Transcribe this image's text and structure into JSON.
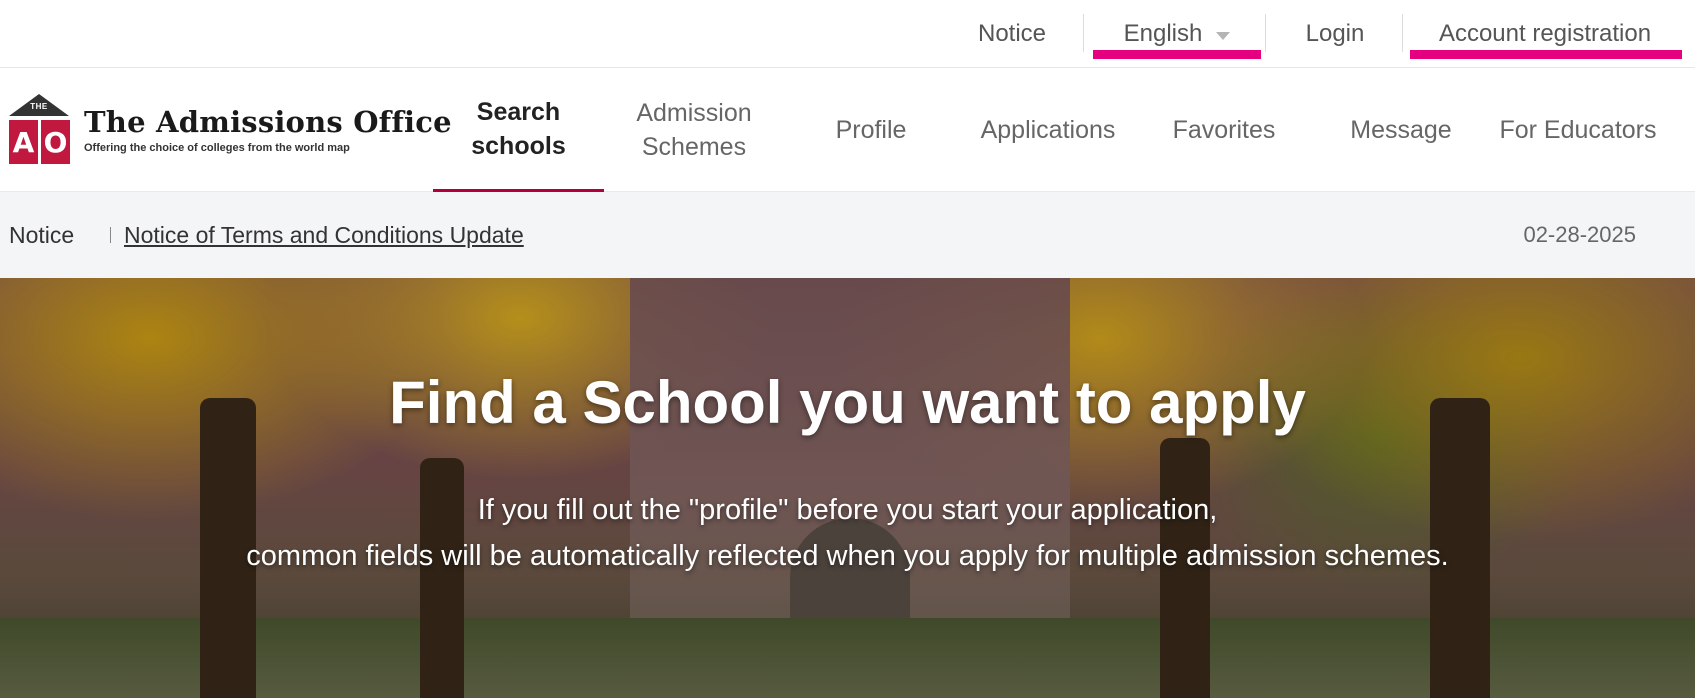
{
  "utility": {
    "notice": "Notice",
    "language": "English",
    "login": "Login",
    "register": "Account registration",
    "accent": "#e5007f"
  },
  "logo": {
    "mark_the": "THE",
    "mark_a": "A",
    "mark_o": "O",
    "title": "The Admissions Office",
    "tagline": "Offering the choice of colleges from the world map",
    "brand_color": "#c0183f"
  },
  "nav": {
    "items": [
      {
        "line1": "Search",
        "line2": "schools",
        "active": true
      },
      {
        "line1": "Admission",
        "line2": "Schemes"
      },
      {
        "line1": "Profile"
      },
      {
        "line1": "Applications"
      },
      {
        "line1": "Favorites"
      },
      {
        "line1": "Message"
      },
      {
        "line1": "For Educators"
      }
    ]
  },
  "notice_strip": {
    "label": "Notice",
    "link": "Notice of Terms and Conditions Update",
    "date": "02-28-2025"
  },
  "hero": {
    "title": "Find a School you want to apply",
    "line1": "If you fill out the \"profile\" before you start your application,",
    "line2": "common fields will be automatically reflected when you apply for multiple admission schemes."
  }
}
